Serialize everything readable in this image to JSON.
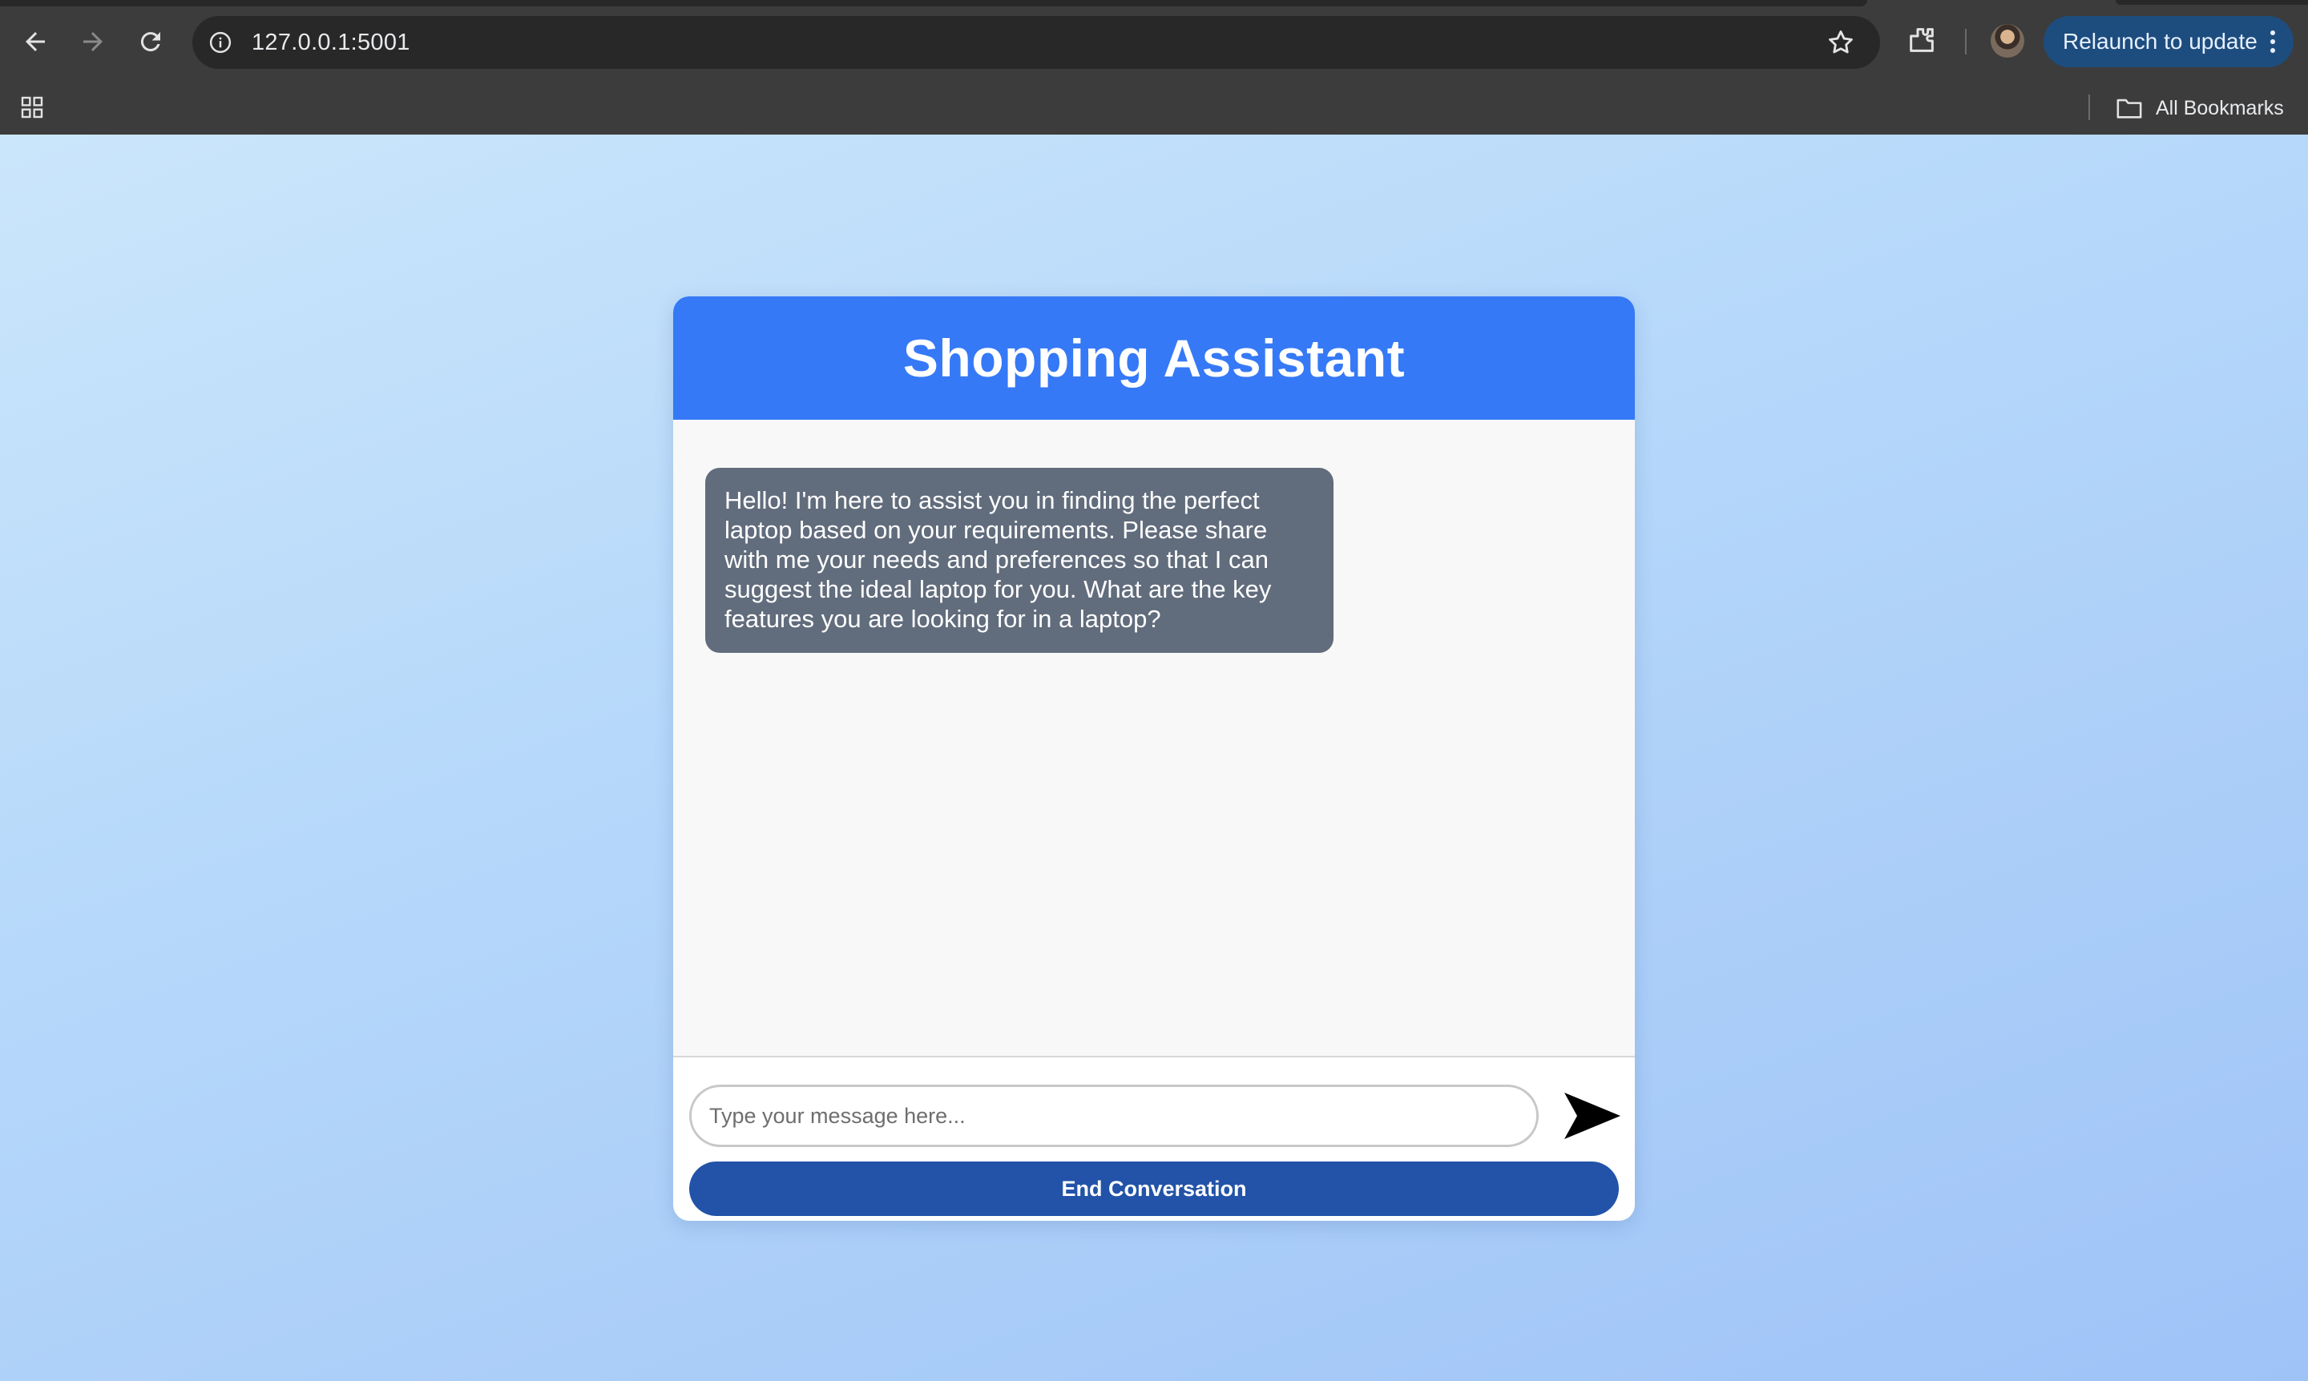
{
  "browser": {
    "url": "127.0.0.1:5001",
    "relaunch_label": "Relaunch to update",
    "all_bookmarks_label": "All Bookmarks",
    "icons": [
      "back-icon",
      "forward-icon",
      "reload-icon",
      "site-info-icon",
      "bookmark-star-icon",
      "extensions-icon",
      "profile-avatar",
      "more-vert-icon",
      "apps-grid-icon",
      "folder-icon"
    ]
  },
  "chat": {
    "title": "Shopping Assistant",
    "messages": [
      {
        "role": "assistant",
        "text": "Hello! I'm here to assist you in finding the perfect laptop based on your requirements. Please share with me your needs and preferences so that I can suggest the ideal laptop for you. What are the key features you are looking for in a laptop?"
      }
    ],
    "input": {
      "value": "",
      "placeholder": "Type your message here..."
    },
    "send_icon": "send-arrow-icon",
    "end_label": "End Conversation"
  },
  "colors": {
    "header": "#3579f6",
    "bubble": "#616c7c",
    "end_button": "#2253a8",
    "relaunch_button": "#1d4d7e"
  }
}
